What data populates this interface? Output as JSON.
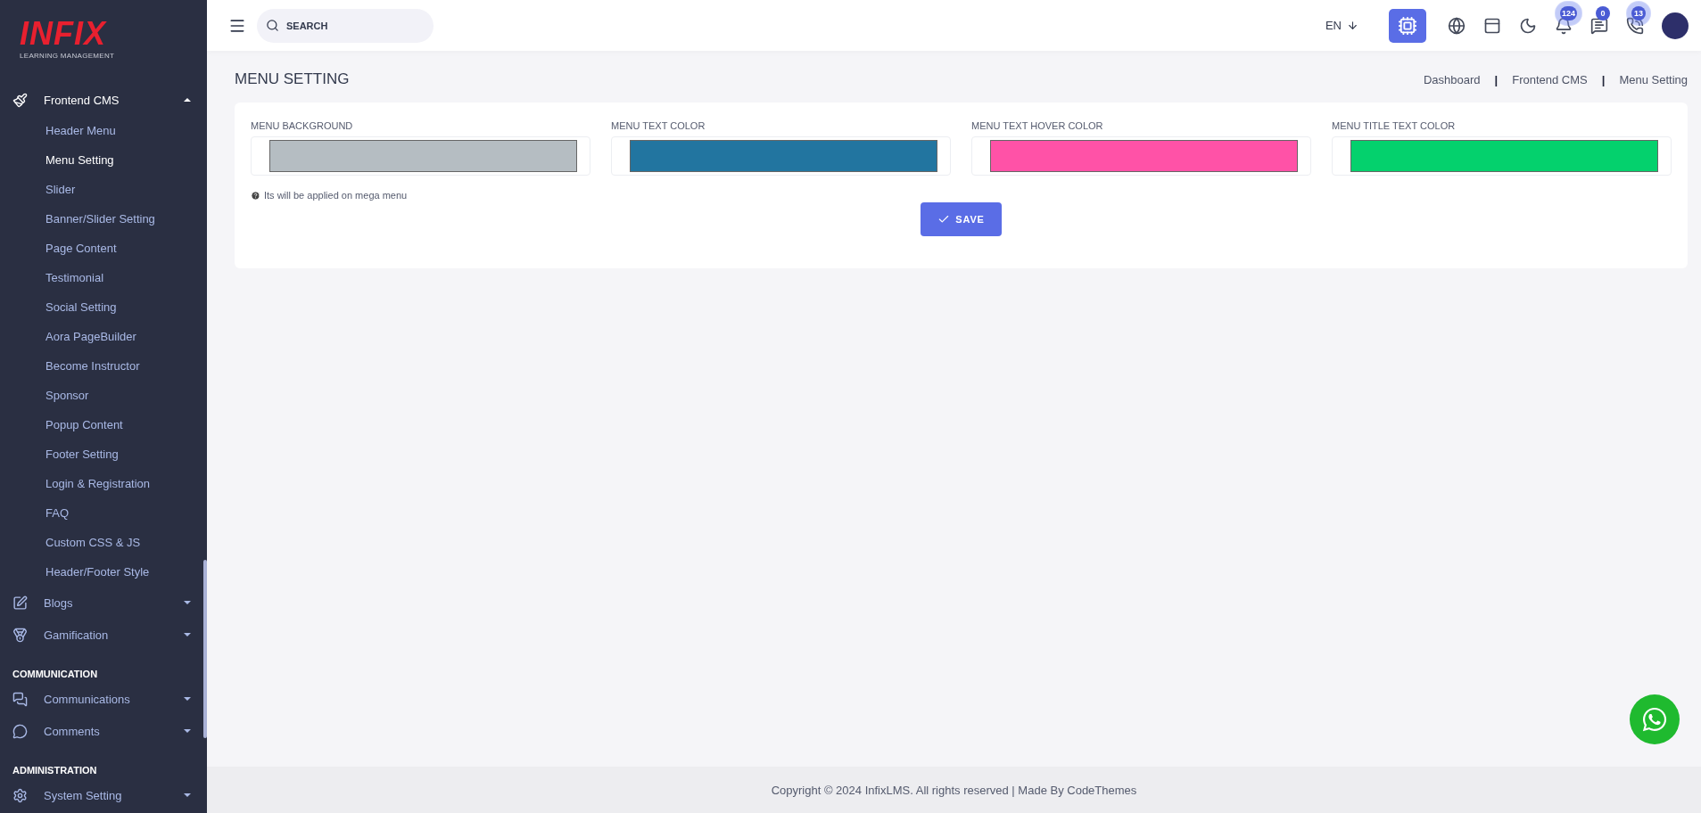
{
  "sidebar": {
    "logo": {
      "wordmark": "INFIX",
      "tagline": "LEARNING MANAGEMENT"
    },
    "items": [
      {
        "kind": "menu",
        "label": "Frontend CMS",
        "expanded": true,
        "children": [
          {
            "label": "Header Menu",
            "selected": false
          },
          {
            "label": "Menu Setting",
            "selected": true
          },
          {
            "label": "Slider",
            "selected": false
          },
          {
            "label": "Banner/Slider Setting",
            "selected": false
          },
          {
            "label": "Page Content",
            "selected": false
          },
          {
            "label": "Testimonial",
            "selected": false
          },
          {
            "label": "Social Setting",
            "selected": false
          },
          {
            "label": "Aora PageBuilder",
            "selected": false
          },
          {
            "label": "Become Instructor",
            "selected": false
          },
          {
            "label": "Sponsor",
            "selected": false
          },
          {
            "label": "Popup Content",
            "selected": false
          },
          {
            "label": "Footer Setting",
            "selected": false
          },
          {
            "label": "Login & Registration",
            "selected": false
          },
          {
            "label": "FAQ",
            "selected": false
          },
          {
            "label": "Custom CSS & JS",
            "selected": false
          },
          {
            "label": "Header/Footer Style",
            "selected": false
          }
        ]
      },
      {
        "kind": "menu",
        "label": "Blogs",
        "expanded": false
      },
      {
        "kind": "menu",
        "label": "Gamification",
        "expanded": false
      },
      {
        "kind": "heading",
        "label": "COMMUNICATION"
      },
      {
        "kind": "menu",
        "label": "Communications",
        "expanded": false
      },
      {
        "kind": "menu",
        "label": "Comments",
        "expanded": false
      },
      {
        "kind": "heading",
        "label": "ADMINISTRATION"
      },
      {
        "kind": "menu",
        "label": "System Setting",
        "expanded": false
      }
    ]
  },
  "topbar": {
    "search": {
      "placeholder": "SEARCH"
    },
    "language": "EN",
    "badges": [
      {
        "count": "124",
        "pulse": true
      },
      {
        "count": "0",
        "pulse": false
      },
      {
        "count": "13",
        "pulse": true
      }
    ]
  },
  "page": {
    "title": "MENU SETTING",
    "breadcrumb": [
      {
        "kind": "link",
        "label": "Dashboard"
      },
      {
        "kind": "separator",
        "label": "|"
      },
      {
        "kind": "link",
        "label": "Frontend CMS"
      },
      {
        "kind": "separator",
        "label": "|"
      },
      {
        "kind": "link",
        "label": "Menu Setting"
      }
    ]
  },
  "fields": [
    {
      "label": "MENU BACKGROUND",
      "color": "#b5bdc2"
    },
    {
      "label": "MENU TEXT COLOR",
      "color": "#2275a0"
    },
    {
      "label": "MENU TEXT HOVER COLOR",
      "color": "#ff52a7"
    },
    {
      "label": "MENU TITLE TEXT COLOR",
      "color": "#04d16d"
    }
  ],
  "note": "Its will be applied on mega menu",
  "save_button": "SAVE",
  "footer": "Copyright © 2024 InfixLMS. All rights reserved | Made By CodeThemes"
}
